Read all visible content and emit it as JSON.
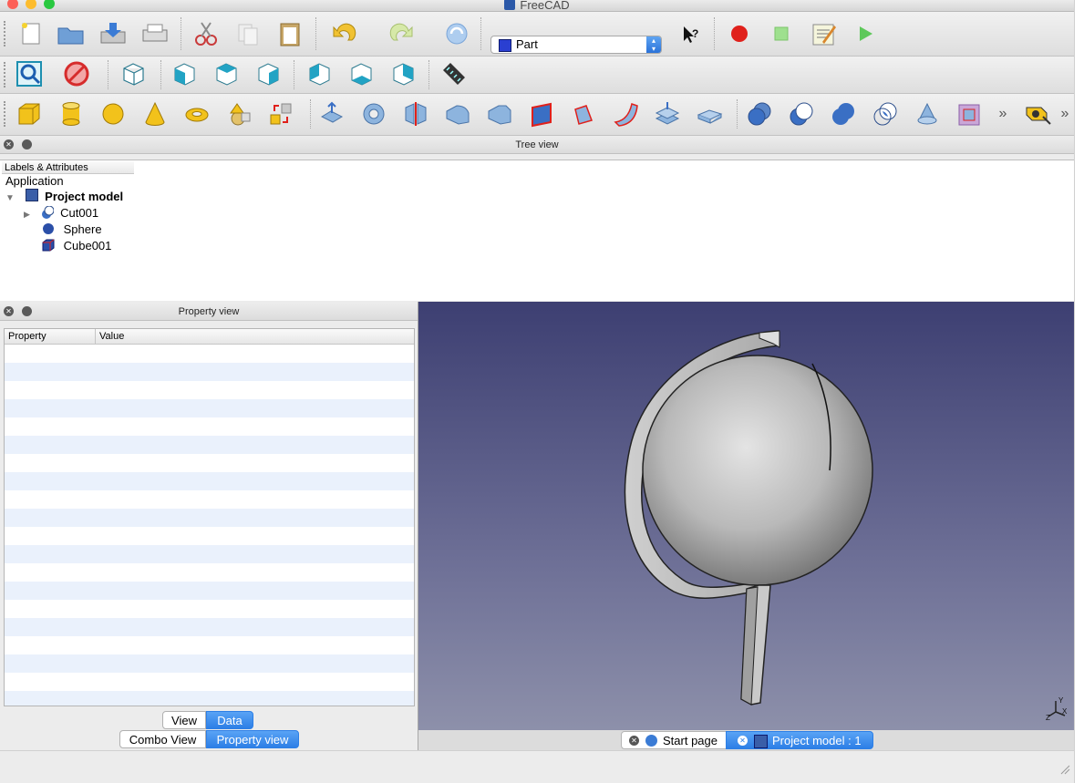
{
  "window": {
    "title": "FreeCAD"
  },
  "toolbar": {
    "workbench": "Part",
    "file_tools": [
      "new-file-icon",
      "open-file-icon",
      "save-file-icon",
      "print-icon"
    ],
    "edit_tools": [
      "cut-icon",
      "copy-icon",
      "paste-icon"
    ],
    "history_tools": [
      "undo-icon",
      "redo-icon",
      "refresh-icon"
    ],
    "macro_tools": [
      "whats-this-icon",
      "record-macro-icon",
      "stop-macro-icon",
      "edit-macro-icon",
      "run-macro-icon"
    ],
    "view_tools": [
      "fit-all-icon",
      "draw-style-icon",
      "isometric-view-icon",
      "front-view-icon",
      "top-view-icon",
      "right-view-icon",
      "rear-view-icon",
      "bottom-view-icon",
      "left-view-icon",
      "measure-icon"
    ],
    "part_tools": [
      "box-icon",
      "cylinder-icon",
      "sphere-icon",
      "cone-icon",
      "torus-icon",
      "primitives-icon",
      "shape-builder-icon",
      "extrude-icon",
      "revolve-icon",
      "mirror-icon",
      "fillet-icon",
      "chamfer-icon",
      "make-face-icon",
      "ruled-surface-icon",
      "loft-icon",
      "sweep-icon",
      "section-icon",
      "cross-sections-icon",
      "compound-icon",
      "boolean-icon",
      "cut-icon",
      "fuse-icon",
      "common-icon",
      "offset-icon",
      "thickness-icon",
      "more-icon",
      "measure-linear-icon",
      "more-icon"
    ]
  },
  "tree_panel": {
    "title": "Tree view",
    "column": "Labels & Attributes",
    "root": "Application",
    "document": "Project model",
    "items": [
      {
        "label": "Cut001",
        "icon": "cut-icon",
        "expandable": true
      },
      {
        "label": "Sphere",
        "icon": "sphere-icon",
        "expandable": false
      },
      {
        "label": "Cube001",
        "icon": "cube-icon",
        "expandable": false
      }
    ]
  },
  "property_panel": {
    "title": "Property view",
    "columns": [
      "Property",
      "Value"
    ],
    "view_tabs": [
      "View",
      "Data"
    ],
    "selected_view_tab": "Data"
  },
  "combo_tabs": [
    "Combo View",
    "Property view"
  ],
  "selected_combo_tab": "Property view",
  "doc_tabs": [
    {
      "label": "Start page",
      "active": false
    },
    {
      "label": "Project model : 1",
      "active": true
    }
  ],
  "colors": {
    "accent": "#2d7fe6",
    "viewport_top": "#3d3f72",
    "viewport_bottom": "#8d90aa",
    "record": "#e0201b",
    "run": "#5ec85a"
  }
}
